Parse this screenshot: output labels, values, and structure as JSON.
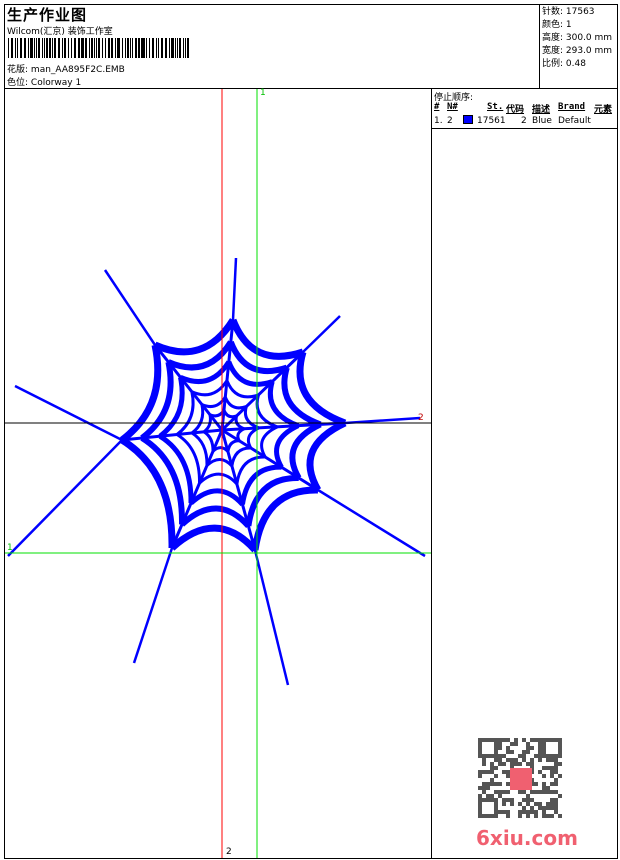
{
  "header": {
    "title": "生产作业图",
    "company": "Wilcom(汇京) 装饰工作室",
    "design_label": "花版:",
    "design_value": "man_AA895F2C.EMB",
    "colorway_label": "色位:",
    "colorway_value": "Colorway 1"
  },
  "info": {
    "stitches": "针数: 17563",
    "colors": "颜色: 1",
    "height": "高度: 300.0 mm",
    "width": "宽度: 293.0 mm",
    "scale": "比例: 0.48"
  },
  "stop_sequence": {
    "title": "停止顺序:",
    "columns": [
      "#",
      "N#",
      "St.",
      "代码",
      "描述",
      "Brand",
      "元素"
    ],
    "rows": [
      {
        "index": "1.",
        "n": "2",
        "color": "#0000ff",
        "stitches": "17561",
        "code": "2",
        "description": "Blue",
        "brand": "Default"
      }
    ]
  },
  "axes": {
    "v_red": "2",
    "v_green": "1",
    "h_black": "2",
    "h_green": "1"
  },
  "colors": {
    "thread": "#0000ff",
    "axis_red": "#ff0000",
    "axis_green": "#00e000"
  },
  "watermark": "6xiu.com"
}
